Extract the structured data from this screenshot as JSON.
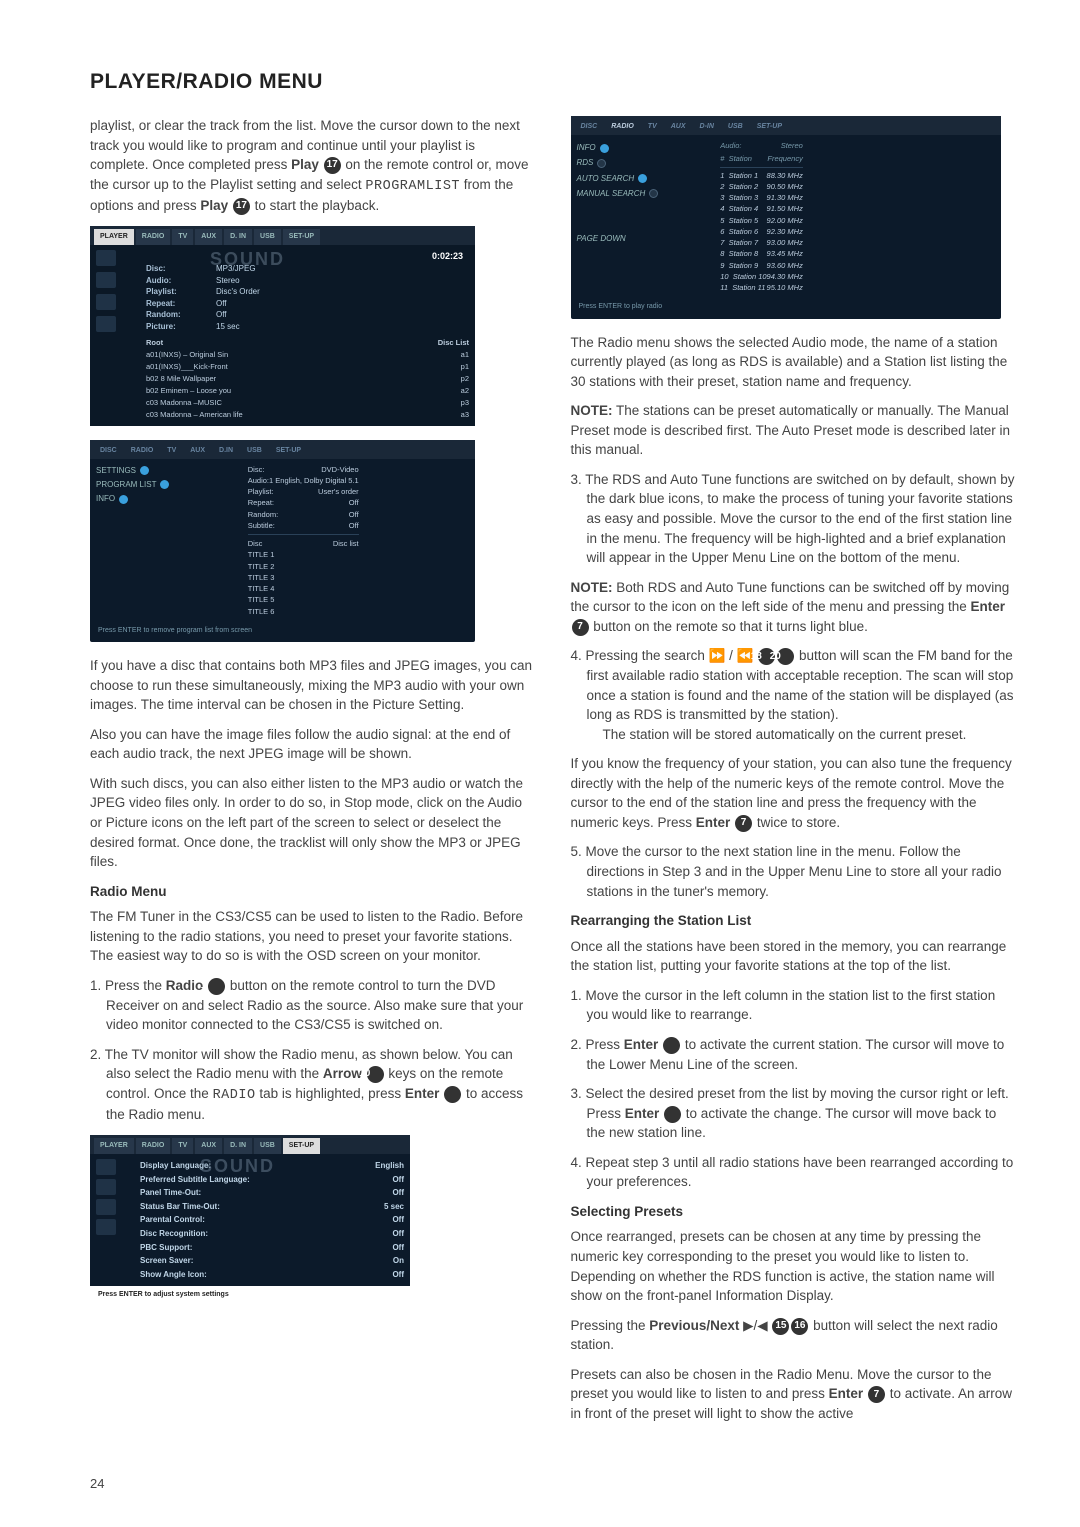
{
  "title": "PLAYER/RADIO MENU",
  "page_number": "24",
  "left_column": {
    "intro": "playlist, or clear the track from the list. Move the cursor down to the next track you would like to program and continue until your playlist is complete. Once completed press ",
    "intro_play1": "Play",
    "intro_badge1": "17",
    "intro2": " on the remote control or, move the cursor up to the Playlist setting and select ",
    "intro_programlist": "PROGRAMLIST",
    "intro3": " from the options and press ",
    "intro_play2": "Play",
    "intro_badge2": "17",
    "intro4": " to start the playback.",
    "p_mp3jpeg": "If you have a disc that contains both MP3 files and JPEG images, you can choose to run these simultaneously, mixing the MP3 audio with your own images. The time interval can be chosen in the Picture Setting.",
    "p_images_follow": "Also you can have the image files follow the audio signal: at the end of each audio track, the next JPEG image will be shown.",
    "p_such_discs": "With such discs, you can also either listen to the MP3 audio or watch the JPEG video files only. In order to do so, in Stop mode, click on the Audio or Picture icons on the left part of the screen to select or deselect the desired format. Once done, the tracklist will only show the MP3 or JPEG files.",
    "h_radio_menu": "Radio Menu",
    "p_fmtuner": "The FM Tuner in the CS3/CS5 can be used to listen to the Radio. Before listening to the radio stations, you need to preset your favorite stations. The easiest way to do so is with the OSD screen on your monitor.",
    "step1_a": "1. Press the ",
    "step1_radio": "Radio",
    "step1_badge": "1",
    "step1_b": " button on the remote control to turn the DVD Receiver on and select Radio as the source. Also make sure that your video monitor connected to the CS3/CS5 is switched on.",
    "step2_a": "2. The TV monitor will show the Radio menu, as shown below. You can also select the Radio menu with the ",
    "step2_arrow": "Arrow",
    "step2_badge1": "10",
    "step2_b": " keys on the remote control. Once the ",
    "step2_radio_mono": "RADIO",
    "step2_c": " tab is highlighted, press ",
    "step2_enter": "Enter",
    "step2_badge2": "7",
    "step2_d": " to access the Radio menu."
  },
  "right_column": {
    "p_radio_menu_shows": "The Radio menu shows the selected Audio mode, the name of a station currently played (as long as RDS is available) and a Station list listing the 30 stations with their preset, station name and frequency.",
    "note1_label": "NOTE:",
    "note1": " The stations can be preset automatically or manually. The Manual Preset mode is described first. The Auto Preset mode is described later in this manual.",
    "step3": "3. The RDS and Auto Tune functions are switched on by default, shown by the dark blue icons, to make the process of tuning your favorite stations as easy and possible. Move the cursor to the end of the first station line in the menu. The frequency will be high-lighted and a brief explanation will appear in the Upper Menu Line on the bottom of the menu.",
    "note2_label": "NOTE:",
    "note2_a": " Both RDS and Auto Tune functions can be switched off by moving the cursor to the icon on the left side of the menu and pressing the ",
    "note2_enter": "Enter",
    "note2_badge": "7",
    "note2_b": " button on the remote so that it turns light blue.",
    "step4_a": "4. Pressing the search ⏩ / ⏪ ",
    "step4_badge1": "18",
    "step4_badge2": "20",
    "step4_b": " button will scan the FM band for the first available radio station with acceptable reception. The scan will stop once a station is found and the name of the station will be displayed (as long as RDS is transmitted by the station).",
    "step4_c": "The station will be stored automatically on the current preset.",
    "p_freq_a": "If you know the frequency of your station, you can also tune the frequency directly with the help of the numeric keys of the remote control. Move the cursor to the end of the station line and press the frequency with the numeric keys. Press ",
    "p_freq_enter": "Enter",
    "p_freq_badge": "7",
    "p_freq_b": " twice to store.",
    "step5": "5. Move the cursor to the next station line in the menu. Follow the directions in Step 3 and in the Upper Menu Line to store all your radio stations in the tuner's memory.",
    "h_rearranging": "Rearranging the Station List",
    "p_rearrange": "Once all the stations have been stored in the memory, you can rearrange the station list, putting your favorite stations at the top of the list.",
    "r_step1": "1. Move the cursor in the left column in the station list to the first station you would like to rearrange.",
    "r_step2_a": "2. Press ",
    "r_step2_enter": "Enter",
    "r_step2_badge": "7",
    "r_step2_b": " to activate the current station. The cursor will move to the Lower Menu Line of the screen.",
    "r_step3_a": "3. Select the desired preset from the list by moving the cursor right or left. Press ",
    "r_step3_enter": "Enter",
    "r_step3_badge": "7",
    "r_step3_b": " to activate the change. The cursor will move back to the new station line.",
    "r_step4": "4. Repeat step 3 until all radio stations have been rearranged according to your preferences.",
    "h_selecting": "Selecting Presets",
    "p_selecting": "Once rearranged, presets can be chosen at any time by pressing the numeric key corresponding to the preset you would like to listen to. Depending on whether the RDS function is active, the station name will show on the front-panel Information Display.",
    "p_prevnext_a": "Pressing the ",
    "p_prevnext_label": "Previous/Next",
    "p_prevnext_sym": " ▶/◀ ",
    "p_prevnext_badge1": "15",
    "p_prevnext_badge2": "16",
    "p_prevnext_b": " button will select the next radio station.",
    "p_presets_a": "Presets can also be chosen in the Radio Menu. Move the cursor to the preset you would like to listen to and press ",
    "p_presets_enter": "Enter",
    "p_presets_badge": "7",
    "p_presets_b": " to activate. An arrow in front of the preset will light to show the active"
  },
  "ss1": {
    "tabs": [
      "PLAYER",
      "RADIO",
      "TV",
      "AUX",
      "D. IN",
      "USB",
      "SET-UP"
    ],
    "time": "0:02:23",
    "rows": [
      {
        "k": "Disc:",
        "v": "MP3/JPEG"
      },
      {
        "k": "Audio:",
        "v": "Stereo"
      },
      {
        "k": "Playlist:",
        "v": "Disc's Order"
      },
      {
        "k": "Repeat:",
        "v": "Off"
      },
      {
        "k": "Random:",
        "v": "Off"
      },
      {
        "k": "Picture:",
        "v": "15 sec"
      }
    ],
    "list_header_left": "Root",
    "list_header_right": "Disc List",
    "tracks": [
      {
        "n": "a01(INXS) – Original Sin",
        "d": "a1"
      },
      {
        "n": "a01(INXS)___Kick-Front",
        "d": "p1"
      },
      {
        "n": "b02 8 Mile Wallpaper",
        "d": "p2"
      },
      {
        "n": "b02 Eminem – Loose you",
        "d": "a2"
      },
      {
        "n": "c03 Madonna –MUSIC",
        "d": "p3"
      },
      {
        "n": "c03 Madonna – American life",
        "d": "a3"
      }
    ]
  },
  "ss2": {
    "tabs": [
      "DISC",
      "RADIO",
      "TV",
      "AUX",
      "D.IN",
      "USB",
      "SET-UP"
    ],
    "left": [
      "SETTINGS",
      "PROGRAM LIST",
      "INFO"
    ],
    "right_pairs": [
      {
        "k": "Disc:",
        "v": "DVD-Video"
      },
      {
        "k": "Audio:",
        "v": "1 English, Dolby Digital 5.1"
      },
      {
        "k": "Playlist:",
        "v": "User's order"
      },
      {
        "k": "Repeat:",
        "v": "Off"
      },
      {
        "k": "Random:",
        "v": "Off"
      },
      {
        "k": "Subtitle:",
        "v": "Off"
      }
    ],
    "titles_header_left": "Disc",
    "titles_header_right": "Disc list",
    "titles": [
      "TITLE 1",
      "TITLE 2",
      "TITLE 3",
      "TITLE 4",
      "TITLE 5",
      "TITLE 6"
    ],
    "footer": "Press ENTER to remove program list from screen"
  },
  "ss3": {
    "tabs": [
      "PLAYER",
      "RADIO",
      "TV",
      "AUX",
      "D. IN",
      "USB",
      "SET-UP"
    ],
    "rows": [
      {
        "k": "Display Language:",
        "v": "English"
      },
      {
        "k": "Preferred Subtitle Language:",
        "v": "Off"
      },
      {
        "k": "Panel Time-Out:",
        "v": "Off"
      },
      {
        "k": "Status Bar Time-Out:",
        "v": "5 sec"
      },
      {
        "k": "Parental Control:",
        "v": "Off"
      },
      {
        "k": "Disc Recognition:",
        "v": "Off"
      },
      {
        "k": "PBC Support:",
        "v": "Off"
      },
      {
        "k": "Screen Saver:",
        "v": "On"
      },
      {
        "k": "Show Angle Icon:",
        "v": "Off"
      }
    ],
    "footer": "Press ENTER to adjust system settings"
  },
  "ss4": {
    "tabs": [
      "DISC",
      "RADIO",
      "TV",
      "AUX",
      "D-IN",
      "USB",
      "SET-UP"
    ],
    "left": [
      "INFO",
      "RDS",
      "AUTO SEARCH",
      "MANUAL SEARCH"
    ],
    "header_col1": "#",
    "header_col2": "Audio:",
    "header_col3": "Station",
    "header_col4": "Stereo",
    "header_col5": "Frequency",
    "stations": [
      {
        "n": "1",
        "name": "Station 1",
        "f": "88.30 MHz"
      },
      {
        "n": "2",
        "name": "Station 2",
        "f": "90.50 MHz"
      },
      {
        "n": "3",
        "name": "Station 3",
        "f": "91.30 MHz"
      },
      {
        "n": "4",
        "name": "Station 4",
        "f": "91.50 MHz"
      },
      {
        "n": "5",
        "name": "Station 5",
        "f": "92.00 MHz"
      },
      {
        "n": "6",
        "name": "Station 6",
        "f": "92.30 MHz"
      },
      {
        "n": "7",
        "name": "Station 7",
        "f": "93.00 MHz"
      },
      {
        "n": "8",
        "name": "Station 8",
        "f": "93.45 MHz"
      },
      {
        "n": "9",
        "name": "Station 9",
        "f": "93.60 MHz"
      },
      {
        "n": "10",
        "name": "Station 10",
        "f": "94.30 MHz"
      },
      {
        "n": "11",
        "name": "Station 11",
        "f": "95.10 MHz"
      }
    ],
    "page_down": "PAGE DOWN",
    "footer": "Press ENTER to play radio"
  }
}
